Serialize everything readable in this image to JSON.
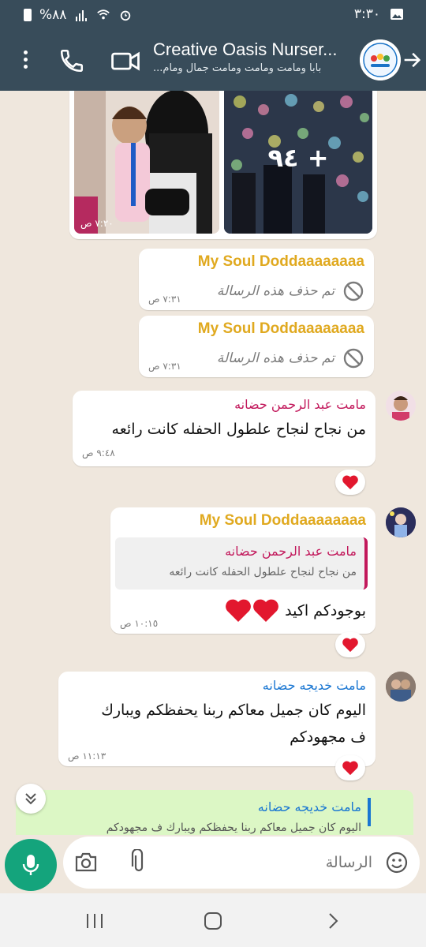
{
  "status_bar": {
    "time": "٣:٣٠",
    "battery": "%٨٨"
  },
  "header": {
    "title": "Creative Oasis Nurser...",
    "subtitle": "بابا ومامت ومامت ومامت جمال ومام...",
    "avatar_text": "CREATIVE OASIS",
    "icons": [
      "menu-icon",
      "phone-icon",
      "video-icon",
      "back-arrow-icon"
    ]
  },
  "media": {
    "more_count": "+ ٩٤",
    "time": "٧:٢٠ ص"
  },
  "messages": [
    {
      "sender": "My Soul Doddaaaaaaaa",
      "deleted_text": "تم حذف هذه الرسالة",
      "time": "٧:٣١ ص"
    },
    {
      "sender": "My Soul Doddaaaaaaaa",
      "deleted_text": "تم حذف هذه الرسالة",
      "time": "٧:٣١ ص"
    },
    {
      "sender": "مامت عبد الرحمن حضانه",
      "text": "من نجاح لنجاح  علطول  الحفله كانت رائعه",
      "time": "٩:٤٨ ص",
      "reaction": "❤️"
    },
    {
      "sender": "My Soul Doddaaaaaaaa",
      "quote_sender": "مامت عبد الرحمن حضانه",
      "quote_text": "من نجاح لنجاح  علطول  الحفله كانت رائعه",
      "text": "بوجودكم اكيد",
      "hearts": "❤️❤️",
      "time": "١٠:١٥ ص",
      "reaction": "❤️"
    },
    {
      "sender": "مامت خديجه حضانه",
      "text_line1": "اليوم كان جميل معاكم ربنا يحفظكم ويبارك",
      "text_line2": "ف مجهودكم",
      "time": "١١:١٣ ص",
      "reaction": "❤️"
    },
    {
      "sender": "مامت خديجه حضانه",
      "text": "اليوم كان جميل معاكم ربنا يحفظكم ويبارك ف مجهودكم"
    }
  ],
  "composer": {
    "placeholder": "الرسالة"
  },
  "colors": {
    "header_bg": "#384c5a",
    "chat_bg": "#efe7dd",
    "gold_sender": "#e0a91f",
    "pink_sender": "#c2185b",
    "blue_sender": "#1976d2",
    "mic_green": "#14a47c",
    "heart_red": "#e2172e"
  }
}
